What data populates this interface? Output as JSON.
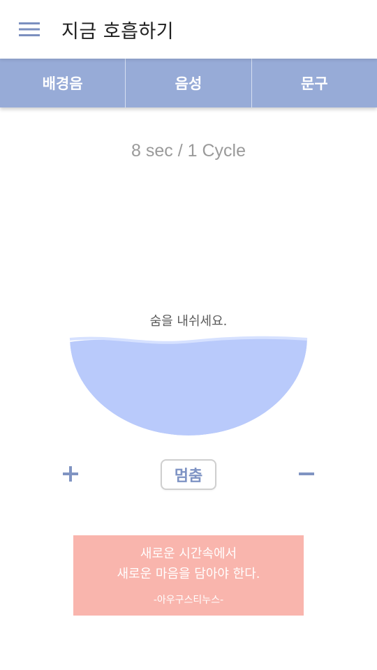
{
  "header": {
    "title": "지금 호흡하기",
    "menu_icon": "hamburger-menu-icon"
  },
  "tabs": [
    {
      "label": "배경음"
    },
    {
      "label": "음성"
    },
    {
      "label": "문구"
    }
  ],
  "breathing": {
    "cycle_text": "8 sec / 1 Cycle",
    "instruction": "숨을 내쉬세요.",
    "fill_color": "#b9cafb"
  },
  "controls": {
    "increase_icon": "plus-icon",
    "stop_label": "멈춤",
    "decrease_icon": "minus-icon"
  },
  "quote": {
    "line1": "새로운 시간속에서",
    "line2": "새로운 마음을 담아야 한다.",
    "author": "-아우구스티누스-",
    "background": "#f9b5ad"
  },
  "colors": {
    "accent": "#97abd7",
    "tab_text": "#ffffff",
    "button_text": "#7e93c4"
  }
}
